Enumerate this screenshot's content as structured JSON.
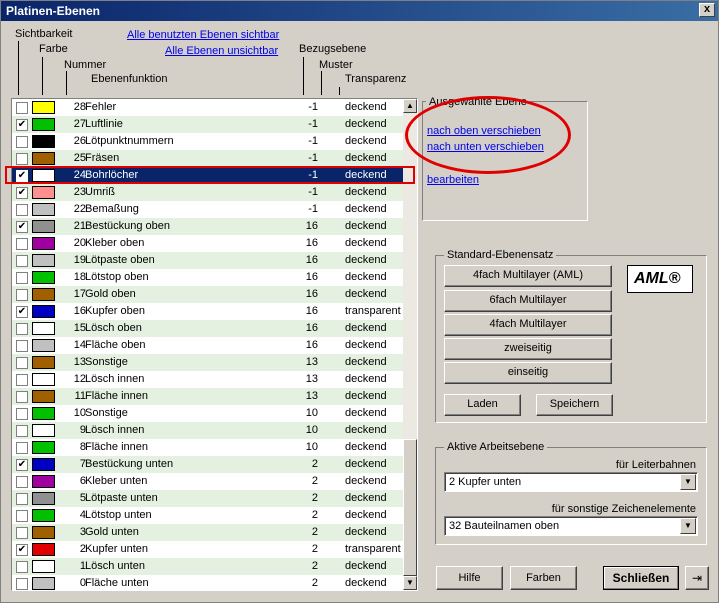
{
  "title": "Platinen-Ebenen",
  "close_label": "x",
  "headers": {
    "sichtbarkeit": "Sichtbarkeit",
    "farbe": "Farbe",
    "nummer": "Nummer",
    "ebenenfunktion": "Ebenenfunktion",
    "bezugsebene": "Bezugsebene",
    "muster": "Muster",
    "transparenz": "Transparenz"
  },
  "links": {
    "all_visible": "Alle benutzten Ebenen sichtbar",
    "all_invisible": "Alle Ebenen unsichtbar"
  },
  "layers": [
    {
      "checked": false,
      "color": "#ffff00",
      "num": "28",
      "name": "Fehler",
      "ref": "-1",
      "trans": "deckend"
    },
    {
      "checked": true,
      "color": "#00c000",
      "num": "27",
      "name": "Luftlinie",
      "ref": "-1",
      "trans": "deckend"
    },
    {
      "checked": false,
      "color": "#000000",
      "num": "26",
      "name": "Lötpunktnummern",
      "ref": "-1",
      "trans": "deckend"
    },
    {
      "checked": false,
      "color": "#a06000",
      "num": "25",
      "name": "Fräsen",
      "ref": "-1",
      "trans": "deckend"
    },
    {
      "checked": true,
      "color": "#ffffff",
      "num": "24",
      "name": "Bohrlöcher",
      "ref": "-1",
      "trans": "deckend",
      "selected": true
    },
    {
      "checked": true,
      "color": "#ff9090",
      "num": "23",
      "name": "Umriß",
      "ref": "-1",
      "trans": "deckend"
    },
    {
      "checked": false,
      "color": "#c0c0c0",
      "num": "22",
      "name": "Bemaßung",
      "ref": "-1",
      "trans": "deckend"
    },
    {
      "checked": true,
      "color": "#909090",
      "num": "21",
      "name": "Bestückung oben",
      "ref": "16",
      "trans": "deckend"
    },
    {
      "checked": false,
      "color": "#a000a0",
      "num": "20",
      "name": "Kleber oben",
      "ref": "16",
      "trans": "deckend"
    },
    {
      "checked": false,
      "color": "#c0c0c0",
      "num": "19",
      "name": "Lötpaste oben",
      "ref": "16",
      "trans": "deckend"
    },
    {
      "checked": false,
      "color": "#00c000",
      "num": "18",
      "name": "Lötstop oben",
      "ref": "16",
      "trans": "deckend"
    },
    {
      "checked": false,
      "color": "#a06000",
      "num": "17",
      "name": "Gold oben",
      "ref": "16",
      "trans": "deckend"
    },
    {
      "checked": true,
      "color": "#0000c0",
      "num": "16",
      "name": "Kupfer oben",
      "ref": "16",
      "trans": "transparent"
    },
    {
      "checked": false,
      "color": "#ffffff",
      "num": "15",
      "name": "Lösch oben",
      "ref": "16",
      "trans": "deckend"
    },
    {
      "checked": false,
      "color": "#c0c0c0",
      "num": "14",
      "name": "Fläche oben",
      "ref": "16",
      "trans": "deckend"
    },
    {
      "checked": false,
      "color": "#a06000",
      "num": "13",
      "name": "Sonstige",
      "ref": "13",
      "trans": "deckend"
    },
    {
      "checked": false,
      "color": "#ffffff",
      "num": "12",
      "name": "Lösch innen",
      "ref": "13",
      "trans": "deckend"
    },
    {
      "checked": false,
      "color": "#a06000",
      "num": "11",
      "name": "Fläche innen",
      "ref": "13",
      "trans": "deckend"
    },
    {
      "checked": false,
      "color": "#00c000",
      "num": "10",
      "name": "Sonstige",
      "ref": "10",
      "trans": "deckend"
    },
    {
      "checked": false,
      "color": "#ffffff",
      "num": "9",
      "name": "Lösch innen",
      "ref": "10",
      "trans": "deckend"
    },
    {
      "checked": false,
      "color": "#00c000",
      "num": "8",
      "name": "Fläche innen",
      "ref": "10",
      "trans": "deckend"
    },
    {
      "checked": true,
      "color": "#0000c0",
      "num": "7",
      "name": "Bestückung unten",
      "ref": "2",
      "trans": "deckend"
    },
    {
      "checked": false,
      "color": "#a000a0",
      "num": "6",
      "name": "Kleber unten",
      "ref": "2",
      "trans": "deckend"
    },
    {
      "checked": false,
      "color": "#909090",
      "num": "5",
      "name": "Lötpaste unten",
      "ref": "2",
      "trans": "deckend"
    },
    {
      "checked": false,
      "color": "#00c000",
      "num": "4",
      "name": "Lötstop unten",
      "ref": "2",
      "trans": "deckend"
    },
    {
      "checked": false,
      "color": "#a06000",
      "num": "3",
      "name": "Gold unten",
      "ref": "2",
      "trans": "deckend"
    },
    {
      "checked": true,
      "color": "#e00000",
      "num": "2",
      "name": "Kupfer unten",
      "ref": "2",
      "trans": "transparent"
    },
    {
      "checked": false,
      "color": "#ffffff",
      "num": "1",
      "name": "Lösch unten",
      "ref": "2",
      "trans": "deckend"
    },
    {
      "checked": false,
      "color": "#c0c0c0",
      "num": "0",
      "name": "Fläche unten",
      "ref": "2",
      "trans": "deckend"
    }
  ],
  "selected_layer": {
    "title": "Ausgewählte Ebene",
    "move_up": "nach oben verschieben",
    "move_down": "nach unten verschieben",
    "edit": "bearbeiten"
  },
  "standard": {
    "title": "Standard-Ebenensatz",
    "b1": "4fach Multilayer (AML)",
    "b2": "6fach Multilayer",
    "b3": "4fach Multilayer",
    "b4": "zweiseitig",
    "b5": "einseitig",
    "load": "Laden",
    "save": "Speichern",
    "logo": "AML®"
  },
  "active": {
    "title": "Aktive Arbeitsebene",
    "tracks_label": "für Leiterbahnen",
    "tracks_value": "2 Kupfer unten",
    "other_label": "für sonstige Zeichenelemente",
    "other_value": "32 Bauteilnamen oben"
  },
  "footer": {
    "help": "Hilfe",
    "colors": "Farben",
    "close": "Schließen"
  },
  "colors": {
    "row_alt": "#e4f0e0",
    "selection": "#0a246a",
    "highlight": "#e00000",
    "link": "#0000ee"
  },
  "icons": [
    "checkbox-icon",
    "scroll-up-icon",
    "scroll-down-icon",
    "dropdown-arrow-icon",
    "exit-icon"
  ]
}
